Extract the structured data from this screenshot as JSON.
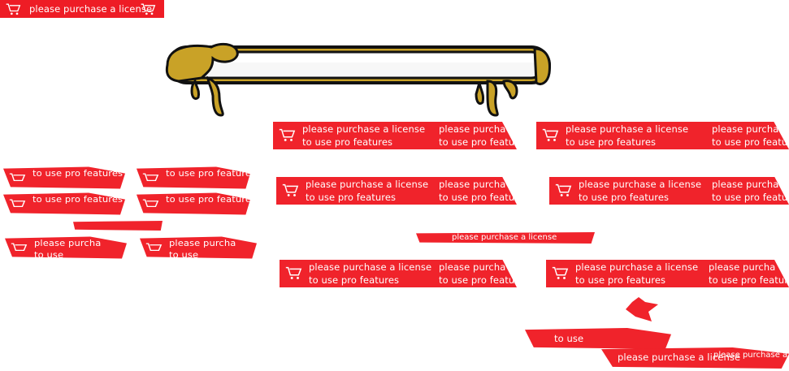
{
  "watermark": {
    "line1": "please purchase a license",
    "line2": "to use pro features",
    "short1": "please purchase a license",
    "partial_purchase": "please purcha",
    "partial_license": "please purchase a license",
    "partial_to_use": "to use",
    "partial_features": "to use pro featu",
    "trail": "please purchase a",
    "cart_icon": "shopping-cart-icon"
  },
  "colors": {
    "watermark_red": "#f0232b",
    "bar_gold": "#c9a227",
    "bar_outline": "#111111",
    "bar_fill_light": "#f7f7f7"
  }
}
